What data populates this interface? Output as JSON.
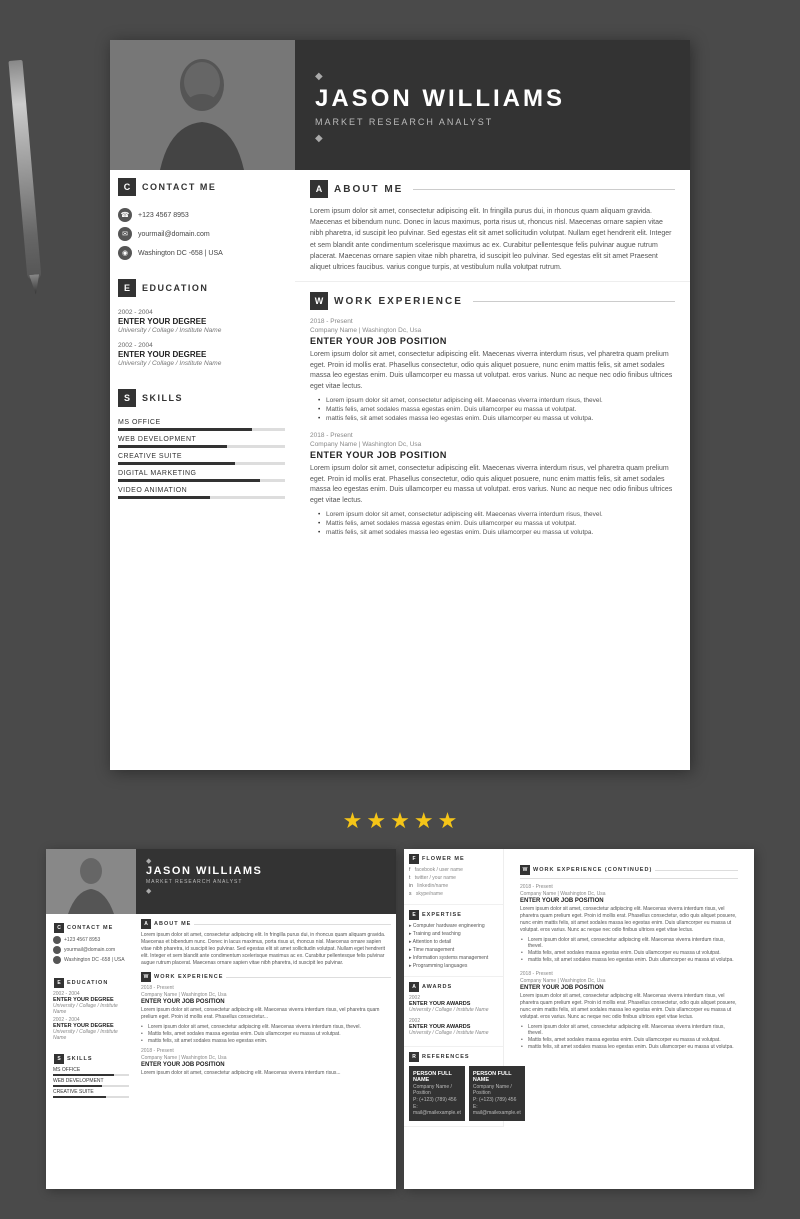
{
  "resume": {
    "name": "JASON WILLIAMS",
    "title": "MARKET RESEARCH ANALYST",
    "diamond": "◆",
    "photo_alt": "Profile photo"
  },
  "sidebar": {
    "contact_section": {
      "letter": "C",
      "title": "CONTACT ME",
      "phone": "+123 4567 8953",
      "email": "yourmail@domain.com",
      "location": "Washington DC -658 | USA"
    },
    "education_section": {
      "letter": "E",
      "title": "EDUCATION",
      "items": [
        {
          "years": "2002 - 2004",
          "degree": "ENTER YOUR DEGREE",
          "school": "University / Collage / Institute Name"
        },
        {
          "years": "2002 - 2004",
          "degree": "ENTER YOUR DEGREE",
          "school": "University / Collage / Institute Name"
        }
      ]
    },
    "skills_section": {
      "letter": "S",
      "title": "SKILLS",
      "items": [
        {
          "name": "MS OFFICE",
          "percent": 80
        },
        {
          "name": "WEB DEVELOPMENT",
          "percent": 65
        },
        {
          "name": "CREATIVE SUITE",
          "percent": 70
        },
        {
          "name": "DIGITAL MARKETING",
          "percent": 85
        },
        {
          "name": "VIDEO ANIMATION",
          "percent": 55
        }
      ]
    }
  },
  "about": {
    "letter": "A",
    "title": "ABOUT ME",
    "text": "Lorem ipsum dolor sit amet, consectetur adipiscing elit. In fringilla purus dui, in rhoncus quam aliquam gravida. Maecenas et bibendum nunc. Donec in lacus maximus, porta risus ut, rhoncus nisl. Maecenas ornare sapien vitae nibh pharetra, id suscipit leo pulvinar. Sed egestas elit sit amet sollicitudin volutpat. Nullam eget hendrerit elit. Integer et sem blandit ante condimentum scelerisque maximus ac ex. Curabitur pellentesque felis pulvinar augue rutrum placerat. Maecenas ornare sapien vitae nibh pharetra, id suscipit leo pulvinar. Sed egestas elit sit amet Praesent aliquet ultrices faucibus. varius congue turpis, at vestibulum nulla volutpat rutrum."
  },
  "work_experience": {
    "letter": "W",
    "title": "WORK EXPERIENCE",
    "jobs": [
      {
        "period": "2018 - Present",
        "company": "Company Name | Washington Dc, Usa",
        "position": "ENTER YOUR JOB POSITION",
        "description": "Lorem ipsum dolor sit amet, consectetur adipiscing elit. Maecenas viverra interdum risus, vel pharetra quam prelium eget. Proin id mollis erat. Phasellus consectetur, odio quis aliquet posuere, nunc enim mattis felis, sit amet sodales massa leo egestas enim. Duis ullamcorper eu massa ut volutpat. eros varius. Nunc ac neque nec odio finibus ultrices eget vitae lectus.",
        "bullets": [
          "Lorem ipsum dolor sit amet, consectetur adipiscing elit. Maecenas viverra interdum risus, thevel.",
          "Mattis felis, amet sodales massa egestas enim. Duis ullamcorper eu massa ut volutpat.",
          "mattis felis, sit amet sodales massa leo egestas enim. Duis ullamcorper eu massa ut volutpa."
        ]
      },
      {
        "period": "2018 - Present",
        "company": "Company Name | Washington Dc, Usa",
        "position": "ENTER YOUR JOB POSITION",
        "description": "Lorem ipsum dolor sit amet, consectetur adipiscing elit. Maecenas viverra interdum risus, vel pharetra quam prelium eget. Proin id mollis erat. Phasellus consectetur, odio quis aliquet posuere, nunc enim mattis felis, sit amet sodales massa leo egestas enim. Duis ullamcorper eu massa ut volutpat. eros varius. Nunc ac neque nec odio finibus ultrices eget vitae lectus.",
        "bullets": [
          "Lorem ipsum dolor sit amet, consectetur adipiscing elit. Maecenas viverra interdum risus, thevel.",
          "Mattis felis, amet sodales massa egestas enim. Duis ullamcorper eu massa ut volutpat.",
          "mattis felis, sit amet sodales massa leo egestas enim. Duis ullamcorper eu massa ut volutpa."
        ]
      }
    ]
  },
  "stars": {
    "count": 5,
    "color": "#f5c518",
    "label": "★★★★★"
  },
  "bottom": {
    "left_page": {
      "contact": {
        "letter": "C",
        "title": "CONTACT ME",
        "phone": "+123 4567 8953",
        "email": "yourmail@domain.com",
        "location": "Washington DC -658 | USA"
      },
      "education": {
        "letter": "E",
        "title": "EDUCATION",
        "items": [
          {
            "years": "2002 - 2004",
            "degree": "ENTER YOUR DEGREE",
            "school": "University / Collage / Institute Name"
          },
          {
            "years": "2002 - 2004",
            "degree": "ENTER YOUR DEGREE",
            "school": "University / Collage / Institute Name"
          }
        ]
      },
      "skills": {
        "letter": "S",
        "title": "SKILLS",
        "items": [
          {
            "name": "MS OFFICE",
            "percent": 80
          },
          {
            "name": "WEB DEVELOPMENT",
            "percent": 65
          },
          {
            "name": "CREATIVE SUITE",
            "percent": 70
          }
        ]
      },
      "about": {
        "letter": "A",
        "title": "ABOUT ME",
        "text": "Lorem ipsum dolor sit amet, consectetur adipiscing elit. In fringilla purus dui, in rhoncus quam aliquam gravida. Maecenas et bibendum nunc..."
      },
      "work": {
        "letter": "W",
        "title": "WORK EXPERIENCE",
        "job1": {
          "period": "2018 - Present",
          "company": "Company Name | Washington Dc, Usa",
          "position": "ENTER YOUR JOB POSITION",
          "description": "Lorem ipsum dolor sit amet, consectetur adipiscing elit. Maecenas viverra interdum risus..."
        }
      }
    },
    "right_page": {
      "flower_me": {
        "letter": "F",
        "title": "FLOWER ME",
        "items": [
          {
            "label": "facebook / user name",
            "icon": "f"
          },
          {
            "label": "twitter / your name",
            "icon": "t"
          },
          {
            "label": "linkedin/name",
            "icon": "in"
          },
          {
            "label": "skype/name",
            "icon": "s"
          }
        ]
      },
      "expertise": {
        "letter": "E",
        "title": "EXPERTISE",
        "items": [
          "Computer hardware engineering",
          "Training and teaching",
          "Attention to detail",
          "Time management",
          "Information systems management",
          "Programming languages"
        ]
      },
      "awards": {
        "letter": "A",
        "title": "AWARDS",
        "items": [
          {
            "year": "2002",
            "name": "ENTER YOUR AWARDS",
            "school": "University / Collage / Institute Name"
          },
          {
            "year": "2002",
            "name": "ENTER YOUR AWARDS",
            "school": "University / Collage / Institute Name"
          }
        ]
      },
      "references": {
        "letter": "R",
        "title": "REFERENCES",
        "people": [
          {
            "name": "PERSON FULL NAME",
            "detail1": "Company Name / Position",
            "detail2": "P: (+123) (789) 456",
            "detail3": "E: mail@mailexample.et"
          },
          {
            "name": "PERSON FULL NAME",
            "detail1": "Company Name / Position",
            "detail2": "P: (+123) (789) 456",
            "detail3": "E: mail@mailexample.et"
          }
        ]
      },
      "work_continued": {
        "letter": "W",
        "title": "WORK EXPERIENCE (CONTINUED)",
        "jobs": [
          {
            "period": "2018 - Present",
            "company": "Company Name | Washington Dc, Usa",
            "position": "ENTER YOUR JOB POSITION",
            "description": "Lorem ipsum dolor sit amet, consectetur adipiscing elit...",
            "bullets": [
              "Lorem ipsum dolor sit amet, consectetur adipiscing elit. Maecenas viverra interdum risus, thevel.",
              "Mattis felis, amet sodales massa egestas enim. Duis ullamcorper eu massa ut volutpat.",
              "mattis felis, sit amet sodales massa leo egestas enim."
            ]
          },
          {
            "period": "2018 - Present",
            "company": "Company Name | Washington Dc, Usa",
            "position": "ENTER YOUR JOB POSITION",
            "description": "Lorem ipsum dolor sit amet, consectetur adipiscing elit...",
            "bullets": [
              "Lorem ipsum dolor sit amet, consectetur adipiscing elit. Maecenas viverra interdum risus, thevel.",
              "Mattis felis, amet sodales massa egestas enim.",
              "mattis felis, sit amet sodales massa leo egestas enim."
            ]
          }
        ]
      }
    }
  }
}
